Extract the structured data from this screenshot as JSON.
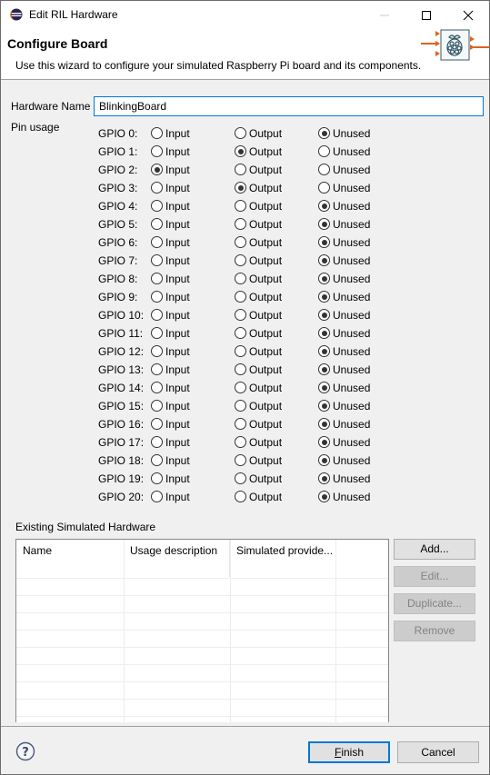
{
  "window": {
    "title": "Edit RIL Hardware",
    "minimize_icon": "minimize-icon",
    "maximize_icon": "maximize-icon",
    "close_icon": "close-icon"
  },
  "header": {
    "title": "Configure Board",
    "description": "Use this wizard to configure your simulated Raspberry Pi board  and its components.",
    "image_icon": "raspberry-pi-block-icon",
    "accent_color": "#e0621b"
  },
  "form": {
    "hardware_name_label": "Hardware Name",
    "hardware_name_value": "BlinkingBoard",
    "pin_usage_label": "Pin usage",
    "options": {
      "input": "Input",
      "output": "Output",
      "unused": "Unused"
    }
  },
  "gpio": [
    {
      "name": "GPIO 0:",
      "selected": "unused"
    },
    {
      "name": "GPIO 1:",
      "selected": "output"
    },
    {
      "name": "GPIO 2:",
      "selected": "input"
    },
    {
      "name": "GPIO 3:",
      "selected": "output"
    },
    {
      "name": "GPIO 4:",
      "selected": "unused"
    },
    {
      "name": "GPIO 5:",
      "selected": "unused"
    },
    {
      "name": "GPIO 6:",
      "selected": "unused"
    },
    {
      "name": "GPIO 7:",
      "selected": "unused"
    },
    {
      "name": "GPIO 8:",
      "selected": "unused"
    },
    {
      "name": "GPIO 9:",
      "selected": "unused"
    },
    {
      "name": "GPIO 10:",
      "selected": "unused"
    },
    {
      "name": "GPIO 11:",
      "selected": "unused"
    },
    {
      "name": "GPIO 12:",
      "selected": "unused"
    },
    {
      "name": "GPIO 13:",
      "selected": "unused"
    },
    {
      "name": "GPIO 14:",
      "selected": "unused"
    },
    {
      "name": "GPIO 15:",
      "selected": "unused"
    },
    {
      "name": "GPIO 16:",
      "selected": "unused"
    },
    {
      "name": "GPIO 17:",
      "selected": "unused"
    },
    {
      "name": "GPIO 18:",
      "selected": "unused"
    },
    {
      "name": "GPIO 19:",
      "selected": "unused"
    },
    {
      "name": "GPIO 20:",
      "selected": "unused"
    }
  ],
  "existing": {
    "label": "Existing Simulated Hardware",
    "columns": [
      "Name",
      "Usage description",
      "Simulated provide..."
    ],
    "rows": [],
    "buttons": [
      {
        "label": "Add...",
        "enabled": true
      },
      {
        "label": "Edit...",
        "enabled": false
      },
      {
        "label": "Duplicate...",
        "enabled": false
      },
      {
        "label": "Remove",
        "enabled": false
      }
    ]
  },
  "footer": {
    "help_icon": "help-icon",
    "finish_label": "Finish",
    "cancel_label": "Cancel"
  }
}
